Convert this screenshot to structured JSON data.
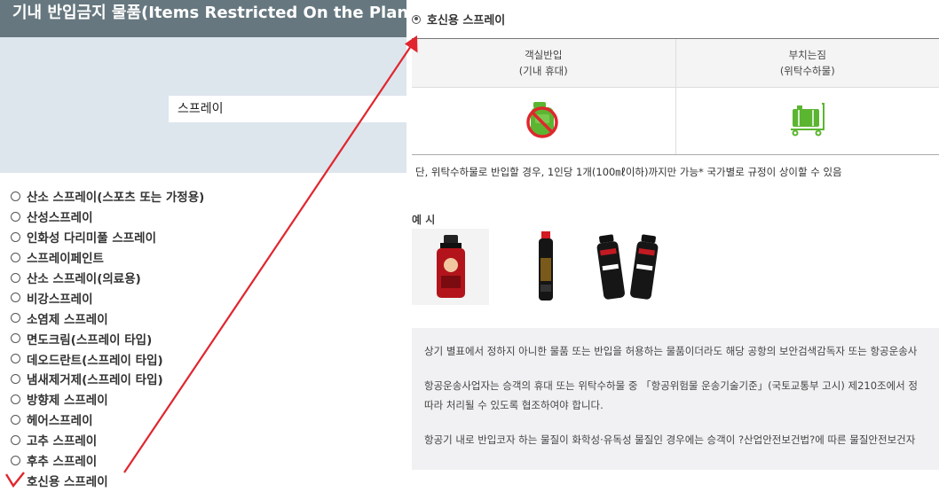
{
  "page": {
    "title": "기내 반입금지 물품(Items Restricted On the Plane)"
  },
  "search": {
    "value": "스프레이"
  },
  "items": [
    {
      "label": "산소 스프레이(스포츠 또는 가정용)"
    },
    {
      "label": "산성스프레이"
    },
    {
      "label": "인화성 다리미풀 스프레이"
    },
    {
      "label": "스프레이페인트"
    },
    {
      "label": "산소 스프레이(의료용)"
    },
    {
      "label": "비강스프레이"
    },
    {
      "label": "소염제 스프레이"
    },
    {
      "label": "면도크림(스프레이 타입)"
    },
    {
      "label": "데오드란트(스프레이 타입)"
    },
    {
      "label": "냄새제거제(스프레이 타입)"
    },
    {
      "label": "방향제 스프레이"
    },
    {
      "label": "헤어스프레이"
    },
    {
      "label": "고추 스프레이"
    },
    {
      "label": "후추 스프레이"
    },
    {
      "label": "호신용 스프레이"
    }
  ],
  "selected_index": 14,
  "detail": {
    "selected_label": "호신용 스프레이",
    "cabin": {
      "label_line1": "객실반입",
      "label_line2": "(기내 휴대)",
      "icon": "prohibited-bag-icon"
    },
    "checked": {
      "label_line1": "부치는짐",
      "label_line2": "(위탁수하물)",
      "icon": "luggage-cart-icon"
    },
    "note": "단, 위탁수하물로 반입할 경우, 1인당 1개(100㎖이하)까지만 가능* 국가별로 규정이 상이할 수 있음",
    "examples_label": "예 시",
    "example_images": [
      "pepper-spray-can-image",
      "pepper-spray-slim-image",
      "police-spray-pair-image"
    ],
    "info_line1": "상기 별표에서 정하지 아니한 물품 또는 반입을 허용하는 물품이더라도 해당 공항의 보안검색감독자 또는 항공운송사",
    "info_line2": "항공운송사업자는 승객의 휴대 또는 위탁수하물 중 「항공위험물 운송기술기준」(국토교통부 고시) 제210조에서 정",
    "info_line3": "따라 처리될 수 있도록 협조하여야 합니다.",
    "info_line4": "항공기 내로 반입코자 하는 물질이 화학성·유독성 물질인 경우에는 승객이 ?산업안전보건법?에 따른 물질안전보건자"
  },
  "colors": {
    "title_bar": "#66777f",
    "search_area": "#dde5ed",
    "arrow": "#e0262e",
    "prohibited": "#e0262e",
    "allowed": "#5cb531"
  }
}
